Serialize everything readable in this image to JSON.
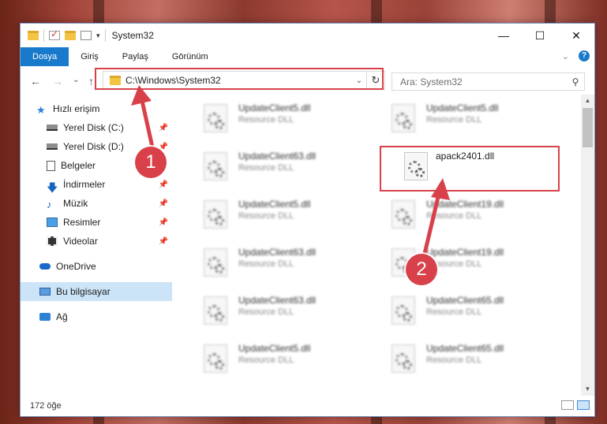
{
  "window": {
    "title": "System32",
    "controls": {
      "minimize": "—",
      "maximize": "☐",
      "close": "✕"
    }
  },
  "ribbon": {
    "tabs": [
      "Dosya",
      "Giriş",
      "Paylaş",
      "Görünüm"
    ],
    "active_tab": "Dosya",
    "help": "?",
    "collapse": "⌄"
  },
  "nav": {
    "back": "←",
    "forward": "→",
    "recent": "⌄",
    "up": "↑",
    "address": "C:\\Windows\\System32",
    "address_dropdown": "⌄",
    "refresh": "↻",
    "search_placeholder": "Ara: System32",
    "search_icon": "⚲"
  },
  "sidebar": {
    "items": [
      {
        "label": "Hızlı erişim",
        "icon": "star-icon",
        "pinned": false
      },
      {
        "label": "Yerel Disk (C:)",
        "icon": "disk-icon",
        "pinned": true
      },
      {
        "label": "Yerel Disk (D:)",
        "icon": "disk-icon",
        "pinned": true
      },
      {
        "label": "Belgeler",
        "icon": "documents-icon",
        "pinned": true
      },
      {
        "label": "İndirmeler",
        "icon": "downloads-icon",
        "pinned": true
      },
      {
        "label": "Müzik",
        "icon": "music-icon",
        "pinned": true
      },
      {
        "label": "Resimler",
        "icon": "pictures-icon",
        "pinned": true
      },
      {
        "label": "Videolar",
        "icon": "videos-icon",
        "pinned": true
      },
      {
        "label": "OneDrive",
        "icon": "onedrive-icon",
        "pinned": false
      },
      {
        "label": "Bu bilgisayar",
        "icon": "this-pc-icon",
        "pinned": false,
        "selected": true
      },
      {
        "label": "Ağ",
        "icon": "network-icon",
        "pinned": false
      }
    ],
    "pin_glyph": "📌"
  },
  "files": [
    {
      "name": "UpdateClient5.dll",
      "type": "Resource DLL"
    },
    {
      "name": "UpdateClient5.dll",
      "type": "Resource DLL"
    },
    {
      "name": "UpdateClient63.dll",
      "type": "Resource DLL"
    },
    {
      "name": "apack2401.dll",
      "type": "",
      "highlighted": true
    },
    {
      "name": "UpdateClient5.dll",
      "type": "Resource DLL"
    },
    {
      "name": "UpdateClient19.dll",
      "type": "Resource DLL"
    },
    {
      "name": "UpdateClient63.dll",
      "type": "Resource DLL"
    },
    {
      "name": "UpdateClient19.dll",
      "type": "Resource DLL"
    },
    {
      "name": "UpdateClient63.dll",
      "type": "Resource DLL"
    },
    {
      "name": "UpdateClient65.dll",
      "type": "Resource DLL"
    },
    {
      "name": "UpdateClient5.dll",
      "type": "Resource DLL"
    },
    {
      "name": "UpdateClient65.dll",
      "type": "Resource DLL"
    }
  ],
  "status": {
    "item_count": "172 öğe"
  },
  "callouts": {
    "one": "1",
    "two": "2"
  },
  "colors": {
    "accent": "#1979ca",
    "callout_red": "#d9414a",
    "selection": "#cce4f7"
  }
}
